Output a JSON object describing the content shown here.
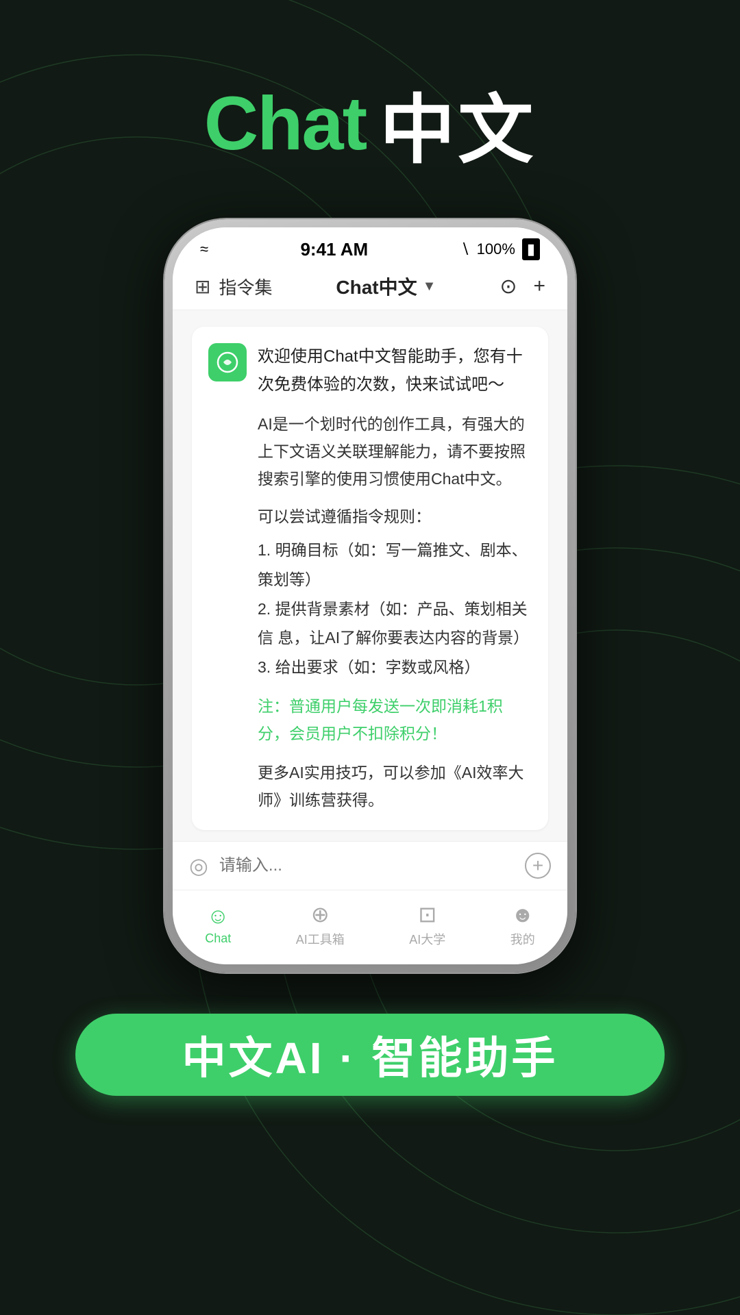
{
  "page": {
    "background_color": "#111a14",
    "title_chat": "Chat",
    "title_chinese": "中文"
  },
  "status_bar": {
    "time": "9:41 AM",
    "wifi": "wifi",
    "bluetooth": "bluetooth",
    "battery_pct": "100%",
    "battery": "battery"
  },
  "nav": {
    "left_icon": "⊞",
    "left_label": "指令集",
    "center_label": "Chat中文",
    "dropdown": "▼",
    "history_icon": "⊙",
    "add_icon": "+"
  },
  "chat": {
    "greeting": "欢迎使用Chat中文智能助手，您有十次免费体验的次数，快来试试吧～",
    "body1": "AI是一个划时代的创作工具，有强大的上下文语义关联理解能力，请不要按照搜索引擎的使用习惯使用Chat中文。",
    "instruction_title": "可以尝试遵循指令规则：",
    "instructions": "1. 明确目标（如：写一篇推文、剧本、策划等）\n2.  提供背景素材（如：产品、策划相关信  息，让AI了解你要表达内容的背景）\n3. 给出要求（如：字数或风格）",
    "highlight": "注：普通用户每发送一次即消耗1积分，会员用户不扣除积分！",
    "footer": "更多AI实用技巧，可以参加《AI效率大师》训练营获得。"
  },
  "input": {
    "placeholder": "请输入..."
  },
  "tabs": [
    {
      "label": "Chat",
      "active": true
    },
    {
      "label": "AI工具箱",
      "active": false
    },
    {
      "label": "AI大学",
      "active": false
    },
    {
      "label": "我的",
      "active": false
    }
  ],
  "cta": {
    "label": "中文AI · 智能助手"
  }
}
